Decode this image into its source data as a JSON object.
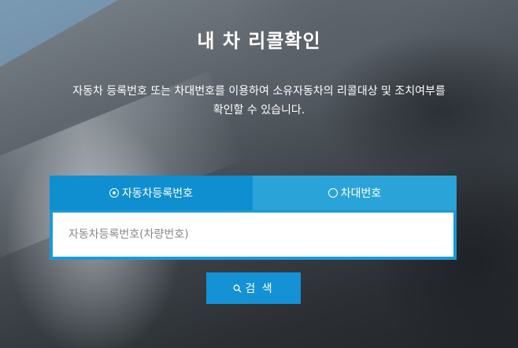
{
  "page": {
    "title": "내 차 리콜확인",
    "description_line1": "자동차 등록번호 또는 차대번호를 이용하여 소유자동차의 리콜대상 및 조치여부를",
    "description_line2": "확인할 수 있습니다."
  },
  "tabs": [
    {
      "label": "자동차등록번호",
      "selected": true
    },
    {
      "label": "차대번호",
      "selected": false
    }
  ],
  "search": {
    "placeholder": "자동차등록번호(차량번호)",
    "value": "",
    "button_label": "검 색"
  },
  "colors": {
    "tab_active": "#0f8fd0",
    "tab_inactive": "#2aa4d8",
    "button": "#1592d6"
  },
  "icons": {
    "button_icon": "search-icon"
  }
}
